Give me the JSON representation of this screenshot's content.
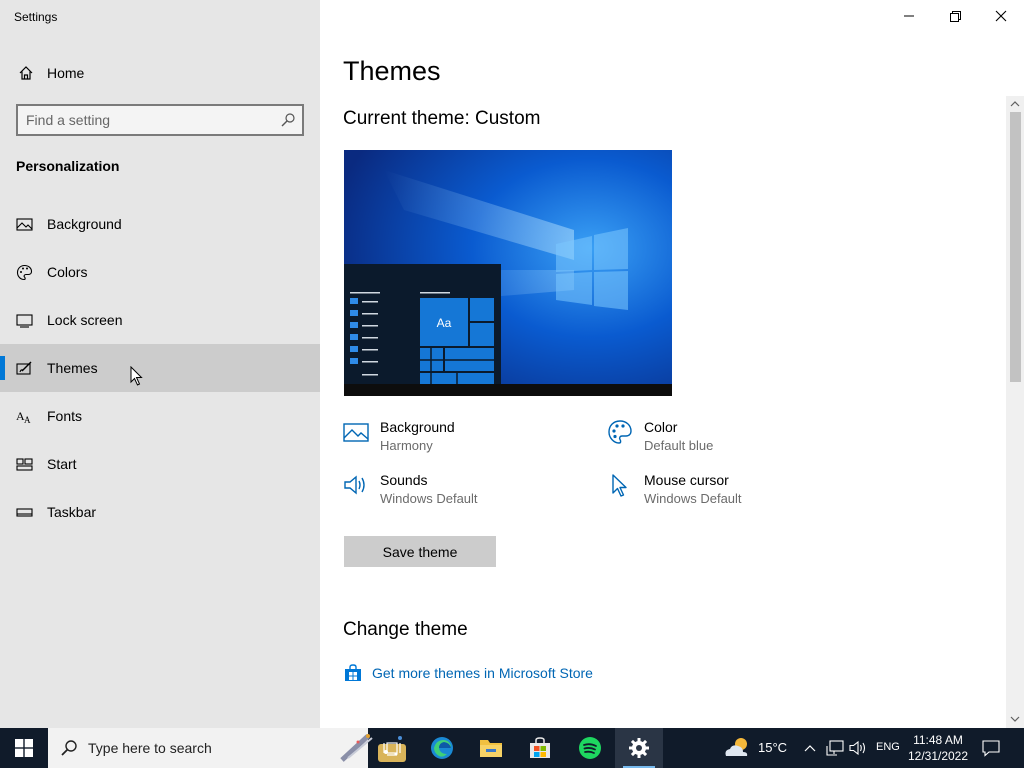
{
  "window": {
    "title": "Settings"
  },
  "sidebar": {
    "home_label": "Home",
    "search_placeholder": "Find a setting",
    "section_title": "Personalization",
    "items": [
      {
        "label": "Background",
        "icon": "picture-icon"
      },
      {
        "label": "Colors",
        "icon": "palette-icon"
      },
      {
        "label": "Lock screen",
        "icon": "lock-screen-icon"
      },
      {
        "label": "Themes",
        "icon": "brush-icon",
        "selected": true
      },
      {
        "label": "Fonts",
        "icon": "fonts-icon"
      },
      {
        "label": "Start",
        "icon": "start-icon"
      },
      {
        "label": "Taskbar",
        "icon": "taskbar-icon"
      }
    ]
  },
  "main": {
    "page_title": "Themes",
    "current_theme_label": "Current theme: Custom",
    "preview_tile_label": "Aa",
    "properties": [
      {
        "name": "Background",
        "value": "Harmony",
        "icon": "picture-icon"
      },
      {
        "name": "Color",
        "value": "Default blue",
        "icon": "palette-icon"
      },
      {
        "name": "Sounds",
        "value": "Windows Default",
        "icon": "speaker-icon"
      },
      {
        "name": "Mouse cursor",
        "value": "Windows Default",
        "icon": "cursor-icon"
      }
    ],
    "save_button": "Save theme",
    "change_theme_title": "Change theme",
    "store_link": "Get more themes in Microsoft Store"
  },
  "taskbar": {
    "search_placeholder": "Type here to search",
    "temperature": "15°C",
    "language": "ENG",
    "time": "11:48 AM",
    "date": "12/31/2022"
  },
  "colors": {
    "accent": "#0078d7",
    "sidebar_bg": "#e6e6e6",
    "link": "#0066b4",
    "taskbar_bg": "#101b2a"
  }
}
